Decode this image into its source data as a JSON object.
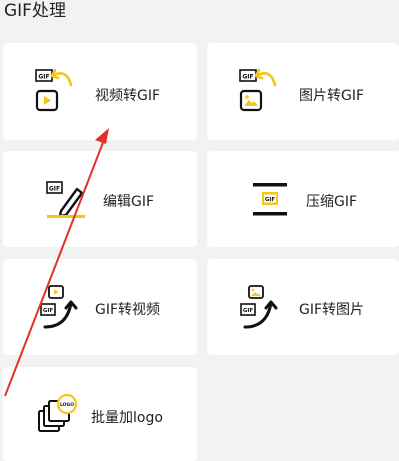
{
  "section": {
    "title": "GIF处理"
  },
  "tools": [
    {
      "label": "视频转GIF",
      "icon": "video-to-gif-icon"
    },
    {
      "label": "图片转GIF",
      "icon": "image-to-gif-icon"
    },
    {
      "label": "编辑GIF",
      "icon": "edit-gif-icon"
    },
    {
      "label": "压缩GIF",
      "icon": "compress-gif-icon"
    },
    {
      "label": "GIF转视频",
      "icon": "gif-to-video-icon"
    },
    {
      "label": "GIF转图片",
      "icon": "gif-to-image-icon"
    },
    {
      "label": "批量加logo",
      "icon": "batch-logo-icon"
    }
  ],
  "icon_text": {
    "gif": "GIF",
    "logo": "LOGO"
  },
  "colors": {
    "accent": "#f5c518",
    "annotation": "#e0312a",
    "card": "#ffffff",
    "background": "#f2f2f2"
  }
}
